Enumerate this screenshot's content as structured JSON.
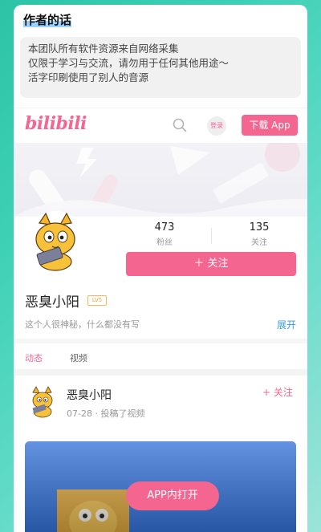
{
  "note": {
    "title": "作者的话",
    "lines": [
      "本团队所有软件资源来自网络采集",
      "仅限于学习与交流，请勿用于任何其他用途～",
      "活字印刷使用了别人的音源"
    ]
  },
  "header": {
    "logo": "bilibili",
    "login_label": "登录",
    "download_label": "下载 App"
  },
  "profile": {
    "fans_count": "473",
    "fans_label": "粉丝",
    "following_count": "135",
    "following_label": "关注",
    "follow_label": "＋ 关注",
    "name": "恶臭小阳",
    "level": "LV5",
    "bio": "这个人很神秘，什么都没有写",
    "expand_label": "展开"
  },
  "tabs": {
    "dynamics": "动态",
    "videos": "视频"
  },
  "feed": {
    "name": "恶臭小阳",
    "meta": "07-28 · 投稿了视频",
    "follow_label": "+ 关注",
    "open_in_app": "APP内打开"
  },
  "colors": {
    "accent": "#f4668f",
    "link": "#3a9bd8",
    "background_teal": "#2cc3a6"
  }
}
